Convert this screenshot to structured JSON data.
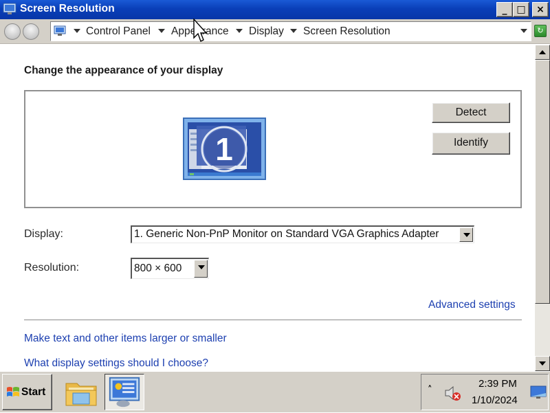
{
  "window": {
    "title": "Screen Resolution",
    "controls": {
      "minimize": "_",
      "maximize": "□",
      "close": "×"
    }
  },
  "address_bar": {
    "breadcrumbs": [
      "Control Panel",
      "Appearance",
      "Display",
      "Screen Resolution"
    ],
    "icon": "control-panel-icon",
    "refresh_icon": "refresh-icon"
  },
  "main": {
    "heading": "Change the appearance of your display",
    "monitor": {
      "number": "1",
      "icon": "monitor-icon"
    },
    "buttons": {
      "detect": "Detect",
      "identify": "Identify"
    },
    "display": {
      "label": "Display:",
      "value": "1. Generic Non-PnP Monitor on Standard VGA Graphics Adapter"
    },
    "resolution": {
      "label": "Resolution:",
      "value": "800 × 600"
    },
    "links": {
      "advanced": "Advanced settings",
      "text_size": "Make text and other items larger or smaller",
      "help": "What display settings should I choose?"
    }
  },
  "taskbar": {
    "start_label": "Start",
    "apps": [
      "file-explorer-icon",
      "display-settings-icon"
    ],
    "tray": {
      "chevron": "˄",
      "volume_icon": "volume-muted-icon",
      "time": "2:39 PM",
      "date": "1/10/2024",
      "show_desktop_icon": "show-desktop-icon"
    }
  },
  "colors": {
    "titlebar": "#0a3fb8",
    "link": "#1c3fb0",
    "chrome": "#d4d0c8"
  }
}
